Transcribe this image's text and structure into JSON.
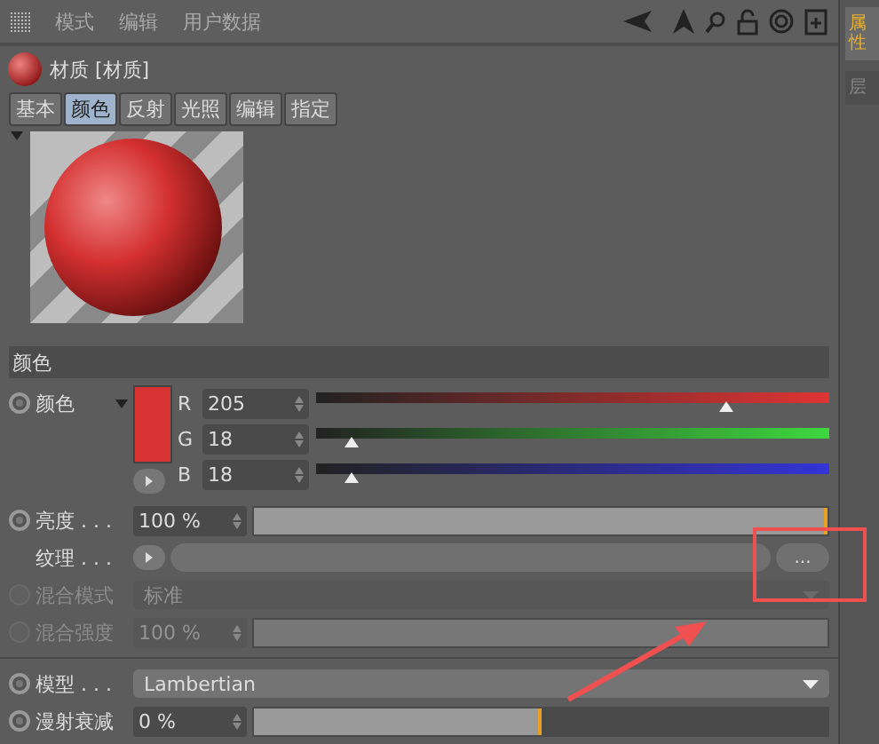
{
  "menu": [
    "模式",
    "编辑",
    "用户数据"
  ],
  "side_tabs": [
    {
      "label": "属性",
      "selected": true
    },
    {
      "label": "层",
      "selected": false
    }
  ],
  "material": {
    "title": "材质 [材质]"
  },
  "tabs": [
    {
      "label": "基本",
      "selected": false
    },
    {
      "label": "颜色",
      "selected": true
    },
    {
      "label": "反射",
      "selected": false
    },
    {
      "label": "光照",
      "selected": false
    },
    {
      "label": "编辑",
      "selected": false
    },
    {
      "label": "指定",
      "selected": false
    }
  ],
  "section": "颜色",
  "color": {
    "label": "颜色",
    "color": "#d83232",
    "channels": [
      {
        "name": "R",
        "value": "205",
        "level": 0.8,
        "color": "#e03434"
      },
      {
        "name": "G",
        "value": "18",
        "level": 0.07,
        "color": "#3ed83e"
      },
      {
        "name": "B",
        "value": "18",
        "level": 0.07,
        "color": "#3434d8"
      }
    ]
  },
  "rows": [
    {
      "kind": "slider",
      "label": "亮度 . . .",
      "value": "100 %",
      "level": 1,
      "enabled": true
    },
    {
      "kind": "texture",
      "label": "纹理 . . .",
      "button": "..."
    },
    {
      "kind": "select",
      "label": "混合模式",
      "value": "标准",
      "enabled": false
    },
    {
      "kind": "slider",
      "label": "混合强度",
      "value": "100 %",
      "level": 1,
      "enabled": false
    },
    {
      "kind": "select",
      "label": "模型 . . .",
      "value": "Lambertian",
      "enabled": true,
      "separated": true
    },
    {
      "kind": "slider",
      "label": "漫射衰减",
      "value": "0 %",
      "level": 0.5,
      "enabled": true
    }
  ]
}
